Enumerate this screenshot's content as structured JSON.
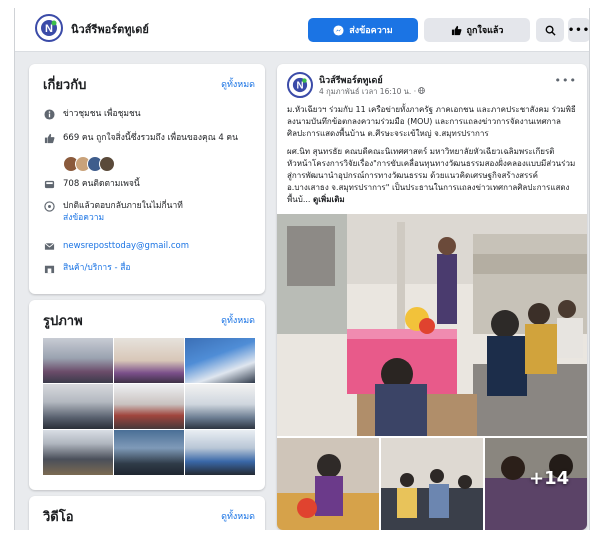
{
  "header": {
    "page_name": "นิวส์รีพอร์ตทูเดย์",
    "message_label": "ส่งข้อความ",
    "like_label": "ถูกใจแล้ว"
  },
  "about": {
    "title": "เกี่ยวกับ",
    "see_all": "ดูทั้งหมด",
    "category": "ข่าวชุมชน เพื่อชุมชน",
    "likes": "669 คน ถูกใจสิ่งนี้ซึ่งรวมถึง เพื่อนของคุณ 4 คน",
    "followers": "708 คนติดตามเพจนี้",
    "response_line1": "ปกติแล้วตอบกลับภายในไม่กี่นาที",
    "response_link": "ส่งข้อความ",
    "email": "newsreposttoday@gmail.com",
    "products": "สินค้า/บริการ - สื่อ"
  },
  "photos": {
    "title": "รูปภาพ",
    "see_all": "ดูทั้งหมด"
  },
  "videos": {
    "title": "วิดีโอ",
    "see_all": "ดูทั้งหมด"
  },
  "post": {
    "author": "นิวส์รีพอร์ตทูเดย์",
    "time": "4 กุมภาพันธ์ เวลา 16:10 น. · ",
    "para1": "ม.หัวเฉียวฯ ร่วมกับ 11 เครือข่ายทั้งภาครัฐ ภาคเอกชน และภาคประชาสังคม ร่วมพิธีลงนามบันทึกข้อตกลงความร่วมมือ (MOU) และการแถลงข่าวการจัดงานเทศกาลศิลปะการแสดงพื้นบ้าน ต.ศีรษะจระเข้ใหญ่ จ.สมุทรปราการ",
    "para2": "ผศ.นิท สุนทรธัย คณบดีคณะนิเทศศาสตร์ มหาวิทยาลัยหัวเฉียวเฉลิมพระเกียรติ หัวหน้าโครงการวิจัยเรื่อง\"การขับเคลื่อนทุนทางวัฒนธรรมสองฝั่งคลองแบบมีส่วนร่วมสู่การพัฒนานำอุปกรณ์การทางวัฒนธรรม ด้วยแนวคิดเศรษฐกิจสร้างสรรค์ อ.บางเสาธง จ.สมุทรปราการ\" เป็นประธานในการแถลงข่าวเทศกาลศิลปะการแสดงพื้นบ้... ",
    "see_more": "ดูเพิ่มเติม",
    "more_photos": "+14"
  }
}
